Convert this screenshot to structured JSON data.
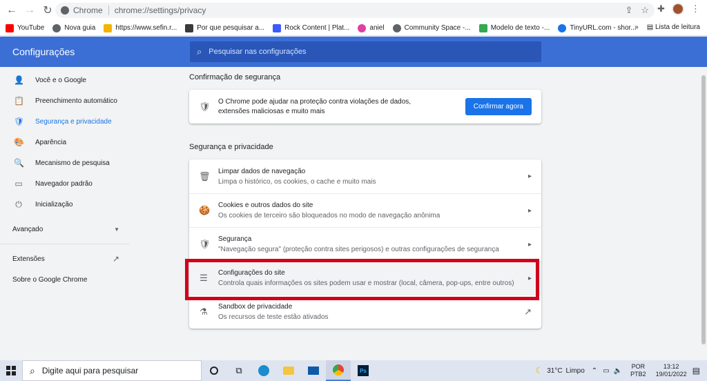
{
  "browser": {
    "site_name": "Chrome",
    "url": "chrome://settings/privacy",
    "bookmarks": [
      {
        "label": "YouTube",
        "color": "#ff0000"
      },
      {
        "label": "Nova guia",
        "color": "#5f6368"
      },
      {
        "label": "https://www.sefin.r...",
        "color": "#f4b400"
      },
      {
        "label": "Por que pesquisar a...",
        "color": "#3a3a3a"
      },
      {
        "label": "Rock Content | Plat...",
        "color": "#3d5afe"
      },
      {
        "label": "aniel",
        "color": "#e040a0"
      },
      {
        "label": "Community Space -...",
        "color": "#5f6368"
      },
      {
        "label": "Modelo de texto -...",
        "color": "#34a853"
      },
      {
        "label": "TinyURL.com - shor...",
        "color": "#1a73e8"
      }
    ],
    "bookmarks_more": "»",
    "reading_list": "Lista de leitura"
  },
  "header": {
    "title": "Configurações",
    "search_placeholder": "Pesquisar nas configurações"
  },
  "sidebar": {
    "items": [
      {
        "label": "Você e o Google",
        "icon": "person-icon",
        "glyph": "👤"
      },
      {
        "label": "Preenchimento automático",
        "icon": "clipboard-icon",
        "glyph": "📋"
      },
      {
        "label": "Segurança e privacidade",
        "icon": "shield-icon",
        "glyph": "🛡"
      },
      {
        "label": "Aparência",
        "icon": "palette-icon",
        "glyph": "🎨"
      },
      {
        "label": "Mecanismo de pesquisa",
        "icon": "search-icon",
        "glyph": "🔍"
      },
      {
        "label": "Navegador padrão",
        "icon": "browser-icon",
        "glyph": "▭"
      },
      {
        "label": "Inicialização",
        "icon": "power-icon",
        "glyph": "⏻"
      }
    ],
    "advanced": "Avançado",
    "extensions": "Extensões",
    "about": "Sobre o Google Chrome"
  },
  "main": {
    "safety_check_title": "Confirmação de segurança",
    "safety_text": "O Chrome pode ajudar na proteção contra violações de dados, extensões maliciosas e muito mais",
    "safety_button": "Confirmar agora",
    "privacy_title": "Segurança e privacidade",
    "rows": [
      {
        "title": "Limpar dados de navegação",
        "sub": "Limpa o histórico, os cookies, o cache e muito mais",
        "icon": "trash-icon",
        "glyph": "🗑"
      },
      {
        "title": "Cookies e outros dados do site",
        "sub": "Os cookies de terceiro são bloqueados no modo de navegação anônima",
        "icon": "cookie-icon",
        "glyph": "🍪"
      },
      {
        "title": "Segurança",
        "sub": "\"Navegação segura\" (proteção contra sites perigosos) e outras configurações de segurança",
        "icon": "shield-icon",
        "glyph": "🛡"
      },
      {
        "title": "Configurações do site",
        "sub": "Controla quais informações os sites podem usar e mostrar (local, câmera, pop-ups, entre outros)",
        "icon": "sliders-icon",
        "glyph": "☰"
      },
      {
        "title": "Sandbox de privacidade",
        "sub": "Os recursos de teste estão ativados",
        "icon": "flask-icon",
        "glyph": "⚗"
      }
    ]
  },
  "taskbar": {
    "search_placeholder": "Digite aqui para pesquisar",
    "weather_temp": "31°C",
    "weather_text": "Limpo",
    "lang_1": "POR",
    "lang_2": "PTB2",
    "time": "13:12",
    "date": "19/01/2022",
    "ps_label": "Ps"
  },
  "colors": {
    "header_bg": "#3b6fd6",
    "accent": "#1a73e8",
    "highlight": "#d0021b"
  }
}
